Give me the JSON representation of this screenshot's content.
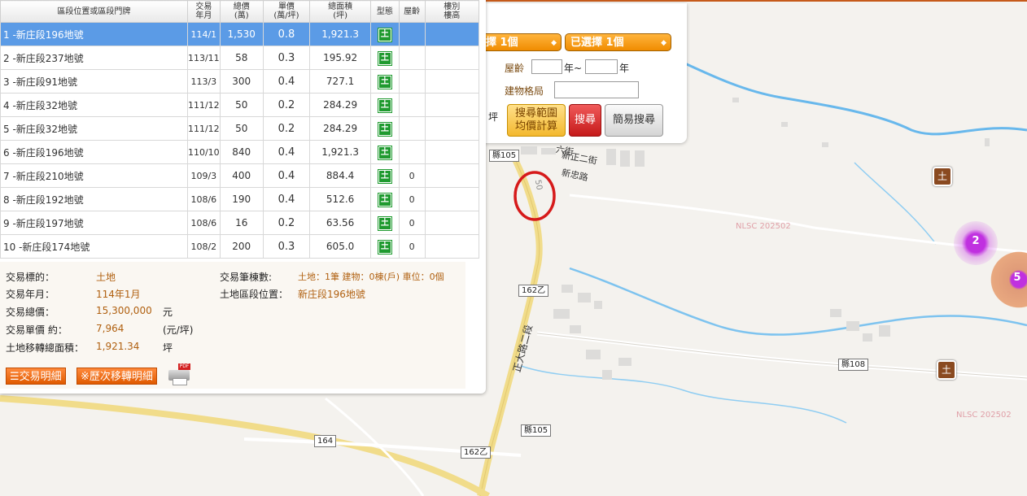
{
  "map": {
    "watermark": "NLSC 202502",
    "roads": {
      "r105_top": "縣105",
      "r162_mid": "162乙",
      "r108": "縣108",
      "r105_bot": "縣105",
      "r164": "164",
      "r162_bot": "162乙"
    },
    "street_labels": {
      "zhengzheng2": "正大路二段",
      "xinzheng2": "新正二街",
      "xinzhong": "新忠路",
      "liu_jie": "六街"
    },
    "contour_50a": "50",
    "contour_50b": "50",
    "cluster_small": "2",
    "cluster_large": "5",
    "land_marker": "土"
  },
  "search_panel": {
    "select1": "擇 1個",
    "select2": "已選擇 1個",
    "age_label": "屋齡",
    "age_sep": "年~",
    "age_unit": "年",
    "layout_label": "建物格局",
    "ping_label": "坪",
    "btn_range_line1": "搜尋範圍",
    "btn_range_line2": "均價計算",
    "btn_search": "搜尋",
    "btn_easy": "簡易搜尋"
  },
  "table": {
    "headers": [
      "區段位置或區段門牌",
      "交易\n年月",
      "總價\n(萬)",
      "單價\n(萬/坪)",
      "總面積\n(坪)",
      "型態",
      "屋齡",
      "樓別\n樓高"
    ],
    "rows": [
      {
        "addr": "1 -新庄段196地號",
        "ym": "114/1",
        "total": "1,530",
        "unit": "0.8",
        "area": "1,921.3",
        "type": "土",
        "age": "",
        "floor": ""
      },
      {
        "addr": "2 -新庄段237地號",
        "ym": "113/11",
        "total": "58",
        "unit": "0.3",
        "area": "195.92",
        "type": "土",
        "age": "",
        "floor": ""
      },
      {
        "addr": "3 -新庄段91地號",
        "ym": "113/3",
        "total": "300",
        "unit": "0.4",
        "area": "727.1",
        "type": "土",
        "age": "",
        "floor": ""
      },
      {
        "addr": "4 -新庄段32地號",
        "ym": "111/12",
        "total": "50",
        "unit": "0.2",
        "area": "284.29",
        "type": "土",
        "age": "",
        "floor": ""
      },
      {
        "addr": "5 -新庄段32地號",
        "ym": "111/12",
        "total": "50",
        "unit": "0.2",
        "area": "284.29",
        "type": "土",
        "age": "",
        "floor": ""
      },
      {
        "addr": "6 -新庄段196地號",
        "ym": "110/10",
        "total": "840",
        "unit": "0.4",
        "area": "1,921.3",
        "type": "土",
        "age": "",
        "floor": ""
      },
      {
        "addr": "7 -新庄段210地號",
        "ym": "109/3",
        "total": "400",
        "unit": "0.4",
        "area": "884.4",
        "type": "土",
        "age": "0",
        "floor": ""
      },
      {
        "addr": "8 -新庄段192地號",
        "ym": "108/6",
        "total": "190",
        "unit": "0.4",
        "area": "512.6",
        "type": "土",
        "age": "0",
        "floor": ""
      },
      {
        "addr": "9 -新庄段197地號",
        "ym": "108/6",
        "total": "16",
        "unit": "0.2",
        "area": "63.56",
        "type": "土",
        "age": "0",
        "floor": ""
      },
      {
        "addr": "10 -新庄段174地號",
        "ym": "108/2",
        "total": "200",
        "unit": "0.3",
        "area": "605.0",
        "type": "土",
        "age": "0",
        "floor": ""
      }
    ]
  },
  "details": {
    "target_label": "交易標的：",
    "target_value": "土地",
    "ym_label": "交易年月：",
    "ym_value": "114年1月",
    "total_label": "交易總價：",
    "total_value": "15,300,000",
    "total_unit": "元",
    "unitprice_label": "交易單價 約：",
    "unitprice_value": "7,964",
    "unitprice_unit": "(元/坪)",
    "area_label": "土地移轉總面積：",
    "area_value": "1,921.34",
    "area_unit": "坪",
    "count_label": "交易筆棟數:",
    "count_value": "土地：1筆 建物：0棟(戶) 車位：0個",
    "location_label": "土地區段位置：",
    "location_value": "新庄段196地號",
    "btn_detail": "交易明細",
    "btn_history": "※歷次移轉明細",
    "pdf_label": "PDF"
  }
}
